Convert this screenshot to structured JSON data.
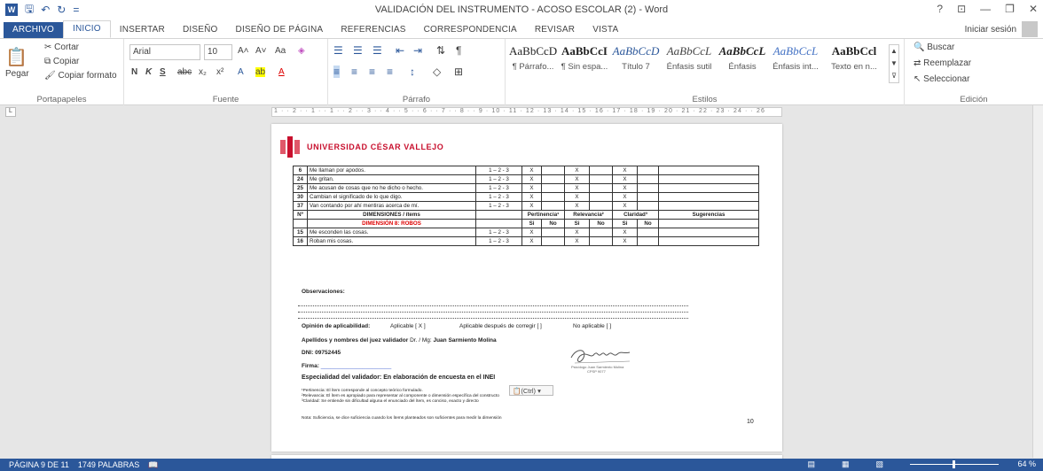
{
  "titlebar": {
    "title": "VALIDACIÓN DEL INSTRUMENTO - ACOSO ESCOLAR (2) - Word",
    "qat_word": "W",
    "qat_save": "🖫",
    "qat_undo": "↶",
    "qat_redo": "↻",
    "qat_more": "=",
    "help": "?",
    "restore": "⊡",
    "minimize": "—",
    "maximize": "❐",
    "close": "✕"
  },
  "tabs": [
    "ARCHIVO",
    "INICIO",
    "INSERTAR",
    "DISEÑO",
    "DISEÑO DE PÁGINA",
    "REFERENCIAS",
    "CORRESPONDENCIA",
    "REVISAR",
    "VISTA"
  ],
  "signin": "Iniciar sesión",
  "ribbon": {
    "clipboard": {
      "paste": "Pegar",
      "cut": "Cortar",
      "copy": "Copiar",
      "format": "Copiar formato",
      "label": "Portapapeles"
    },
    "font": {
      "name": "Arial",
      "size": "10",
      "label": "Fuente",
      "bold": "N",
      "italic": "K",
      "underline": "S",
      "strike": "abc",
      "sub": "x₂",
      "sup": "x²",
      "grow": "A˄",
      "shrink": "A˅",
      "case": "Aa",
      "effects": "A",
      "highlight": "ab",
      "color": "A"
    },
    "paragraph": {
      "label": "Párrafo"
    },
    "styles": {
      "label": "Estilos",
      "items": [
        {
          "preview": "AaBbCcDc",
          "name": "¶ Párrafo..."
        },
        {
          "preview": "AaBbCcI",
          "name": "¶ Sin espa..."
        },
        {
          "preview": "AaBbCcD",
          "name": "Título 7"
        },
        {
          "preview": "AaBbCcL",
          "name": "Énfasis sutil"
        },
        {
          "preview": "AaBbCcL",
          "name": "Énfasis"
        },
        {
          "preview": "AaBbCcL",
          "name": "Énfasis int..."
        },
        {
          "preview": "AaBbCcl",
          "name": "Texto en n..."
        }
      ]
    },
    "editing": {
      "label": "Edición",
      "find": "Buscar",
      "replace": "Reemplazar",
      "select": "Seleccionar"
    }
  },
  "ruler": "1 · · 2 · · 1 · · 1 · · 2 · · 3 · · 4 · · 5 · · 6 · · 7 · · 8 · · 9 · 10 · 11 · 12 · 13 · 14 · 15 · 16 · 17 · 18 · 19 · 20 · 21 · 22 · 23 · 24 · · 26",
  "document": {
    "university": "UNIVERSIDAD CÉSAR VALLEJO",
    "rows1": [
      [
        "6",
        "Me llaman por apodos.",
        "1 – 2 - 3",
        "X",
        "",
        "X",
        "",
        "X",
        ""
      ],
      [
        "24",
        "Me gritan.",
        "1 – 2 - 3",
        "X",
        "",
        "X",
        "",
        "X",
        ""
      ],
      [
        "25",
        "Me acusan de cosas que no he dicho o hecho.",
        "1 – 2 - 3",
        "X",
        "",
        "X",
        "",
        "X",
        ""
      ],
      [
        "30",
        "Cambian el significado de lo que digo.",
        "1 – 2 - 3",
        "X",
        "",
        "X",
        "",
        "X",
        ""
      ],
      [
        "37",
        "Van contando por ahí mentiras acerca de mí.",
        "1 – 2 - 3",
        "X",
        "",
        "X",
        "",
        "X",
        ""
      ]
    ],
    "header": {
      "n": "Nº",
      "dim": "DIMENSIONES / ítems",
      "pert": "Pertinencia¹",
      "rel": "Relevancia²",
      "cla": "Claridad³",
      "sug": "Sugerencias",
      "si": "Si",
      "no": "No"
    },
    "dimension8": "DIMENSIÓN 8: ROBOS",
    "rows2": [
      [
        "15",
        "Me esconden las cosas.",
        "1 – 2 - 3",
        "X",
        "",
        "X",
        "",
        "X",
        ""
      ],
      [
        "16",
        "Roban mis cosas.",
        "1 – 2 - 3",
        "X",
        "",
        "X",
        "",
        "X",
        ""
      ]
    ],
    "observaciones": "Observaciones:",
    "opinion_label": "Opinión de aplicabilidad:",
    "aplicable": "Aplicable [ X ]",
    "despues": "Aplicable después de corregir [  ]",
    "no_aplicable": "No aplicable [  ]",
    "juez_label": "Apellidos y nombres del juez validador",
    "juez_title": "Dr. / Mg:",
    "juez_name": "Juan Sarmiento Molina",
    "dni": "DNI: 09752445",
    "firma": "Firma:",
    "firma_line": "______________________",
    "especialidad": "Especialidad del validador: En elaboración de encuesta en el INEI",
    "note1": "¹Pertinencia: El ítem corresponde al concepto teórico formulado.",
    "note2": "²Relevancia: El ítem es apropiado para representar al componente o dimensión específica del constructo",
    "note3": "³Claridad: Se entiende sin dificultad alguna el enunciado del ítem, es conciso, exacto y directo",
    "nota": "Nota: Suficiencia, se dice suficiencia cuando los ítems planteados son suficientes para medir la dimensión",
    "page_number": "10",
    "sig_caption1": "Psicólogo Juan Sarmiento Molina",
    "sig_caption2": "CPSP 9077",
    "ctrl": "(Ctrl) ▾"
  },
  "status": {
    "page": "PÁGINA 9 DE 11",
    "words": "1749 PALABRAS",
    "zoom": "64 %"
  }
}
